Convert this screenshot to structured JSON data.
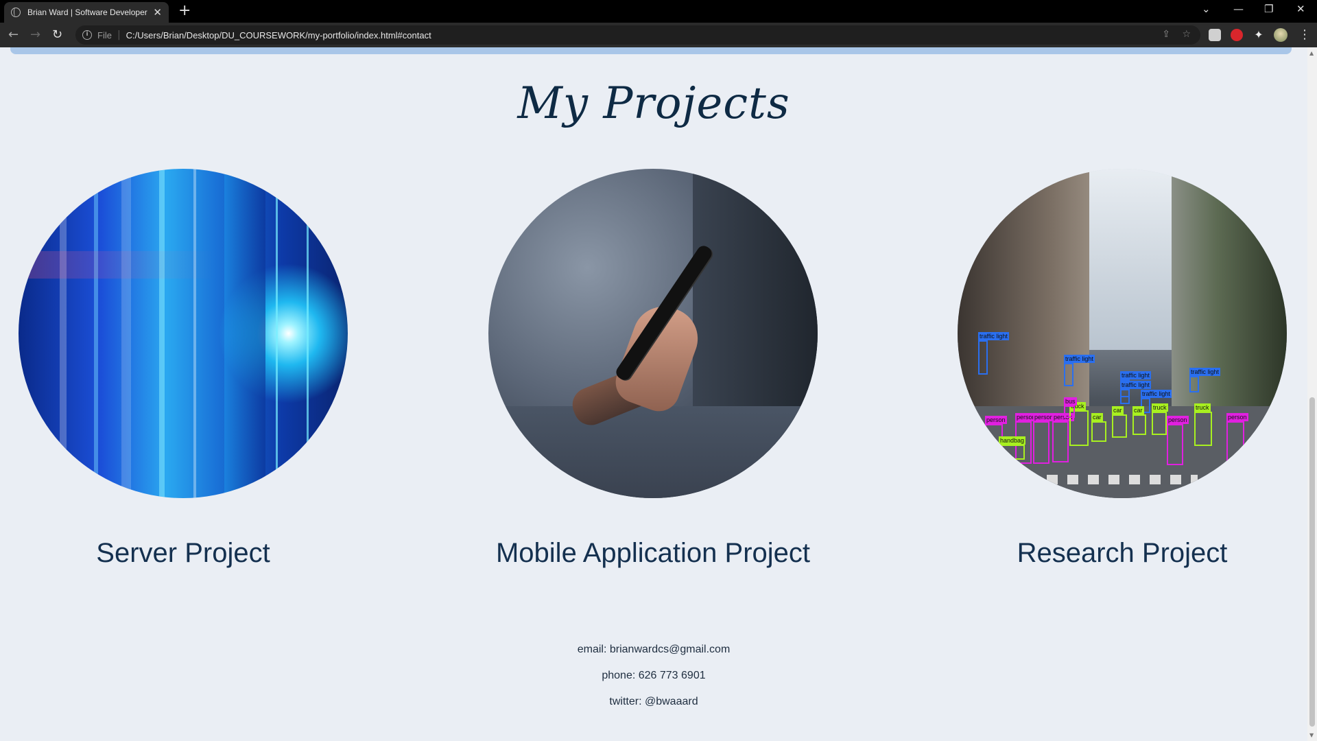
{
  "browser": {
    "tab_title": "Brian Ward | Software Developer",
    "tab_close": "✕",
    "new_tab": "+",
    "url_scheme": "File",
    "url": "C:/Users/Brian/Desktop/DU_COURSEWORK/my-portfolio/index.html#contact",
    "window_controls": {
      "dropdown": "⌄",
      "minimize": "—",
      "restore": "❐",
      "close": "✕"
    },
    "nav": {
      "back": "←",
      "forward": "→",
      "reload": "↻"
    },
    "extension_icons": [
      "reader-icon",
      "adblock-icon",
      "puzzle-icon",
      "profile-avatar"
    ],
    "menu": "⋮"
  },
  "page": {
    "section_title": "My Projects",
    "projects": [
      {
        "label": "Server Project",
        "image": "server-data-center-image"
      },
      {
        "label": "Mobile Application Project",
        "image": "hand-holding-phone-image"
      },
      {
        "label": "Research Project",
        "image": "street-object-detection-image"
      }
    ],
    "detections": [
      "traffic light",
      "traffic light",
      "traffic light",
      "traffic light",
      "traffic light",
      "traffic light",
      "person",
      "person",
      "person",
      "person",
      "person",
      "person",
      "car",
      "car",
      "car",
      "truck",
      "truck",
      "truck",
      "bus",
      "handbag"
    ],
    "contact": {
      "email": "email: brianwardcs@gmail.com",
      "phone": "phone: 626 773 6901",
      "twitter": "twitter: @bwaaard"
    }
  },
  "colors": {
    "page_background": "#eaeef4",
    "heading": "#0e2a44",
    "nav_strip": "#a9c6e8",
    "detect_blue": "#2a6ff0",
    "detect_magenta": "#e020e0",
    "detect_green": "#a8f020"
  }
}
